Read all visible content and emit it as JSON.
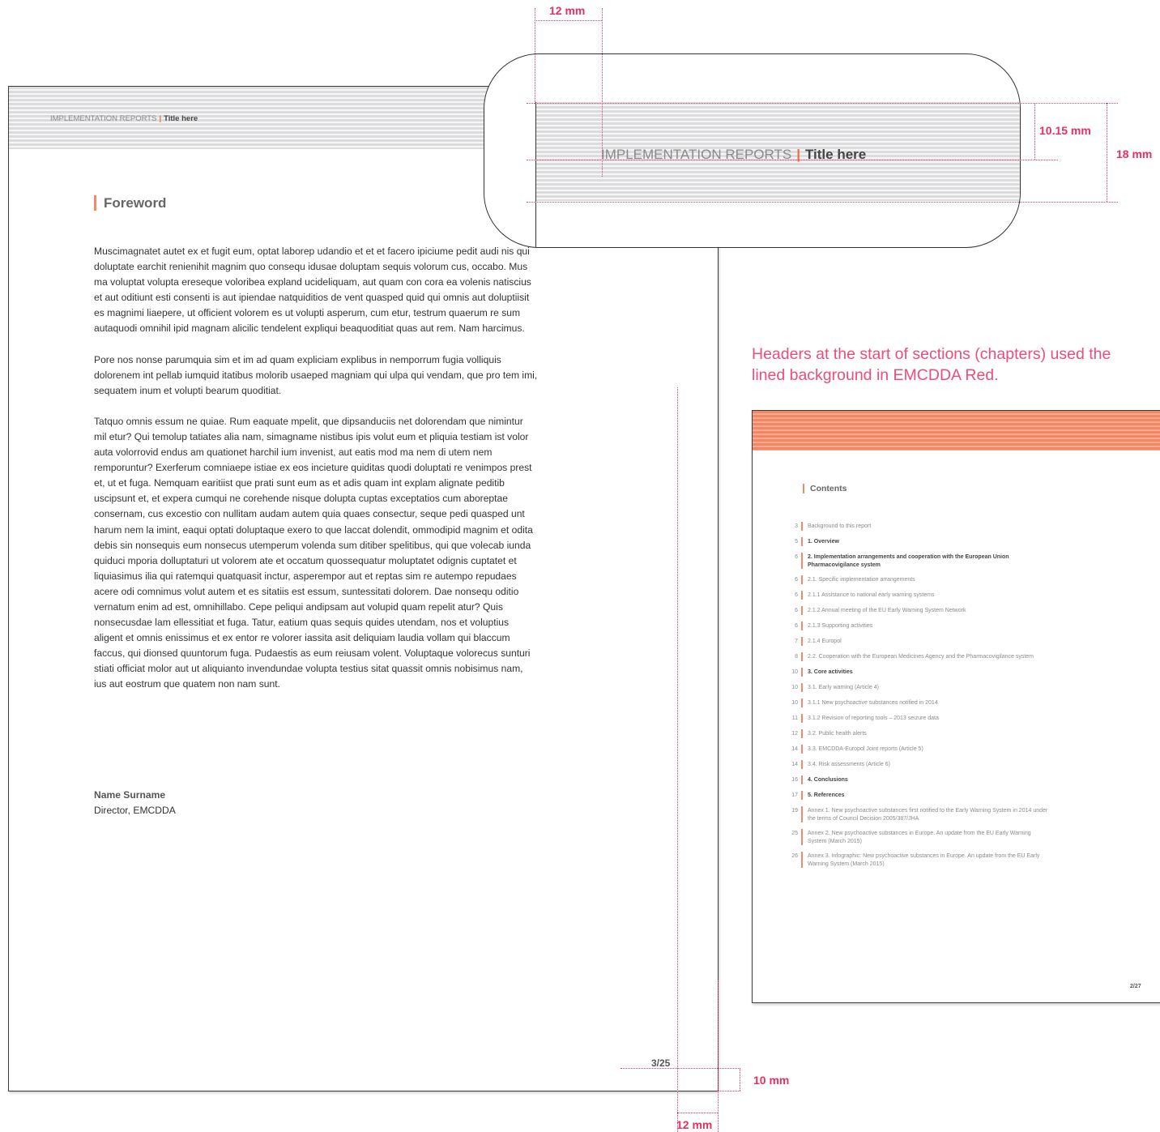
{
  "main_page": {
    "header": {
      "series": "IMPLEMENTATION REPORTS",
      "separator": "|",
      "title": "Title here"
    },
    "section_title": "Foreword",
    "paragraphs": [
      "Muscimagnatet autet ex et fugit eum, optat laborep udandio et et et facero ipiciume pedit audi nis qui doluptate earchit renienihit magnim quo consequ idusae doluptam sequis volorum cus, occabo. Mus ma voluptat volupta ereseque voloribea expland ucideliquam, aut quam con cora ea volenis natiscius et aut oditiunt esti consenti is aut ipiendae natquiditios de vent quasped quid qui omnis aut doluptiisit es magnimi liaepere, ut officient volorem es ut volupti asperum, cum etur, testrum quaerum re sum autaquodi omnihil ipid magnam alicilic tendelent expliqui beaquoditiat quas aut rem. Nam harcimus.",
      "Pore nos nonse parumquia sim et im ad quam expliciam explibus in nemporrum fugia volliquis dolorenem int pellab iumquid itatibus molorib usaeped magniam qui ulpa qui vendam, que pro tem imi, sequatem inum et volupti bearum quoditiat.",
      "Tatquo omnis essum ne quiae. Rum eaquate mpelit, que dipsanduciis net dolorendam que nimintur mil etur? Qui temolup tatiates alia nam, simagname nistibus ipis volut eum et pliquia testiam ist volor auta volorrovid endus am quationet harchil ium invenist, aut eatis mod ma nem di utem nem remporuntur? Exerferum comniaepe istiae ex eos incieture quiditas quodi doluptati re venimpos prest et, ut et fuga. Nemquam earitiist que prati sunt eum as et adis quam int explam alignate peditib uscipsunt et, et expera cumqui ne corehende nisque dolupta cuptas exceptatios cum aboreptae consernam, cus excestio con nullitam audam autem quia quaes consectur, seque pedi quasped unt harum nem la imint, eaqui optati doluptaque exero to que laccat dolendit, ommodipid magnim et odita debis sin nonsequis eum nonsecus utemperum volenda sum ditiber spelitibus, qui que volecab iunda quiduci mporia dolluptaturi ut volorem ate et occatum quossequatur moluptatet odignis cuptatet et liquiasimus ilia qui ratemqui quatquasit inctur, asperempor aut et reptas sim re autempo repudaes acere odi comnimus volut autem et es sitatiis est essum, suntessitati dolorem. Dae nonsequ oditio vernatum enim ad est, omnihillabo. Cepe peliqui andipsam aut volupid quam repelit atur? Quis nonsecusdae lam ellessitiat et fuga. Tatur, eatium quas sequis quides utendam, nos et voluptius aligent et omnis enissimus et ex entor re volorer iassita asit deliquiam laudia vollam qui blaccum faccus, qui dionsed quuntorum fuga. Pudaestis as eum reiusam volent. Voluptaque volorecus sunturi stiati officiat molor aut ut aliquianto invendundae volupta testius sitat quassit omnis nobisimus nam, ius aut eostrum que quatem non nam sunt."
    ],
    "signature": {
      "name": "Name Surname",
      "role": "Director, EMCDDA"
    },
    "page_number": "3/25"
  },
  "magnifier": {
    "header": {
      "series": "IMPLEMENTATION REPORTS",
      "separator": "|",
      "title": "Title here"
    }
  },
  "dimensions": {
    "top_margin": "12 mm",
    "text_height": "10.15 mm",
    "header_height": "18 mm",
    "bottom_margin": "10 mm",
    "right_margin": "12 mm"
  },
  "caption": "Headers at the start of sections (chapters) used the lined background in EMCDDA Red.",
  "contents_page": {
    "title": "Contents",
    "items": [
      {
        "page": "3",
        "label": "Background to this report",
        "bold": false
      },
      {
        "page": "5",
        "label": "1. Overview",
        "bold": true
      },
      {
        "page": "6",
        "label": "2. Implementation arrangements and cooperation with the European Union Pharmacovigilance system",
        "bold": true
      },
      {
        "page": "6",
        "label": "2.1. Specific implementation arrangements",
        "bold": false
      },
      {
        "page": "6",
        "label": "2.1.1 Assistance to national early warning systems",
        "bold": false
      },
      {
        "page": "6",
        "label": "2.1.2 Annual meeting of the EU Early Warning System Network",
        "bold": false
      },
      {
        "page": "6",
        "label": "2.1.3 Supporting activities",
        "bold": false
      },
      {
        "page": "7",
        "label": "2.1.4 Europol",
        "bold": false
      },
      {
        "page": "8",
        "label": "2.2. Cooperation with the European Medicines Agency and the Pharmacovigilance system",
        "bold": false
      },
      {
        "page": "10",
        "label": "3. Core activities",
        "bold": true
      },
      {
        "page": "10",
        "label": "3.1. Early warning (Article 4)",
        "bold": false
      },
      {
        "page": "10",
        "label": "3.1.1 New psychoactive substances notified in 2014",
        "bold": false
      },
      {
        "page": "11",
        "label": "3.1.2 Revision of reporting tools – 2013 seizure data",
        "bold": false
      },
      {
        "page": "12",
        "label": "3.2. Public health alerts",
        "bold": false
      },
      {
        "page": "14",
        "label": "3.3. EMCDDA-Europol Joint reports (Article 5)",
        "bold": false
      },
      {
        "page": "14",
        "label": "3.4. Risk assessments (Article 6)",
        "bold": false
      },
      {
        "page": "16",
        "label": "4. Conclusions",
        "bold": true
      },
      {
        "page": "17",
        "label": "5. References",
        "bold": true
      },
      {
        "page": "19",
        "label": "Annex 1. New psychoactive substances first notified to the Early Warning System in 2014 under the terms of Council Decision 2005/387/JHA",
        "bold": false
      },
      {
        "page": "25",
        "label": "Annex 2. New psychoactive substances in Europe. An update from the EU Early Warning System (March 2015)",
        "bold": false
      },
      {
        "page": "26",
        "label": "Annex 3. Infographic: New psychoactive substances in Europe. An update from the EU Early Warning System (March 2015)",
        "bold": false
      }
    ],
    "page_number": "2/27"
  },
  "colors": {
    "accent_red": "#ef6a4b",
    "dimension_pink": "#e6305f",
    "caption_pink": "#ec4d7a",
    "stripe_grey": "#dcdcde",
    "stripe_red": "#f08866"
  }
}
